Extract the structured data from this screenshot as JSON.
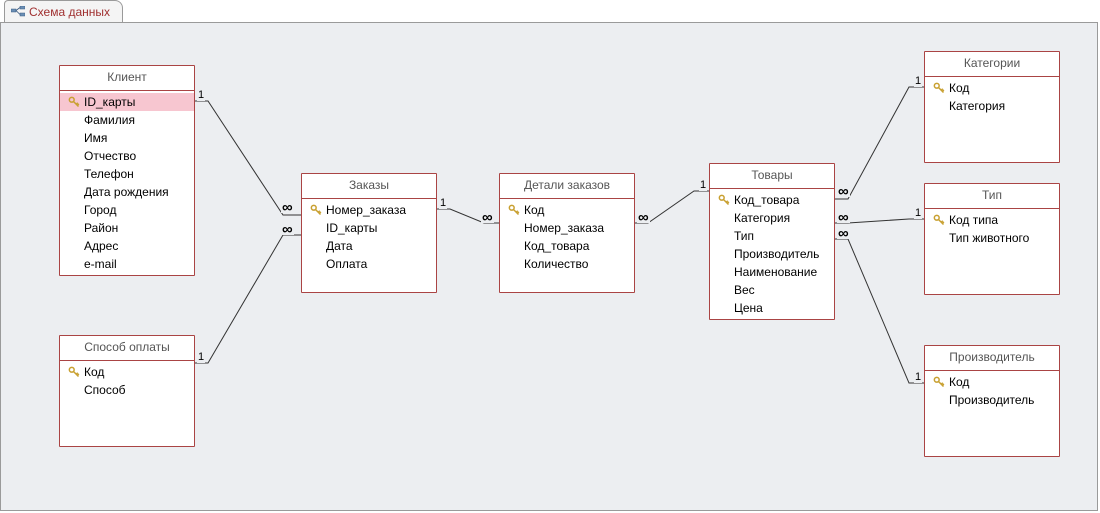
{
  "tab": {
    "label": "Схема данных"
  },
  "tables": {
    "client": {
      "title": "Клиент",
      "fields": [
        "ID_карты",
        "Фамилия",
        "Имя",
        "Отчество",
        "Телефон",
        "Дата рождения",
        "Город",
        "Район",
        "Адрес",
        "e-mail"
      ],
      "keys": [
        0
      ],
      "selected": 0
    },
    "payment": {
      "title": "Способ оплаты",
      "fields": [
        "Код",
        "Способ"
      ],
      "keys": [
        0
      ]
    },
    "orders": {
      "title": "Заказы",
      "fields": [
        "Номер_заказа",
        "ID_карты",
        "Дата",
        "Оплата"
      ],
      "keys": [
        0
      ]
    },
    "orderDetails": {
      "title": "Детали заказов",
      "fields": [
        "Код",
        "Номер_заказа",
        "Код_товара",
        "Количество"
      ],
      "keys": [
        0
      ]
    },
    "products": {
      "title": "Товары",
      "fields": [
        "Код_товара",
        "Категория",
        "Тип",
        "Производитель",
        "Наименование",
        "Вес",
        "Цена"
      ],
      "keys": [
        0
      ]
    },
    "categories": {
      "title": "Категории",
      "fields": [
        "Код",
        "Категория"
      ],
      "keys": [
        0
      ]
    },
    "type": {
      "title": "Тип",
      "fields": [
        "Код типа",
        "Тип животного"
      ],
      "keys": [
        0
      ]
    },
    "manufacturer": {
      "title": "Производитель",
      "fields": [
        "Код",
        "Производитель"
      ],
      "keys": [
        0
      ]
    }
  },
  "cardinality": {
    "one": "1",
    "many": "∞"
  }
}
